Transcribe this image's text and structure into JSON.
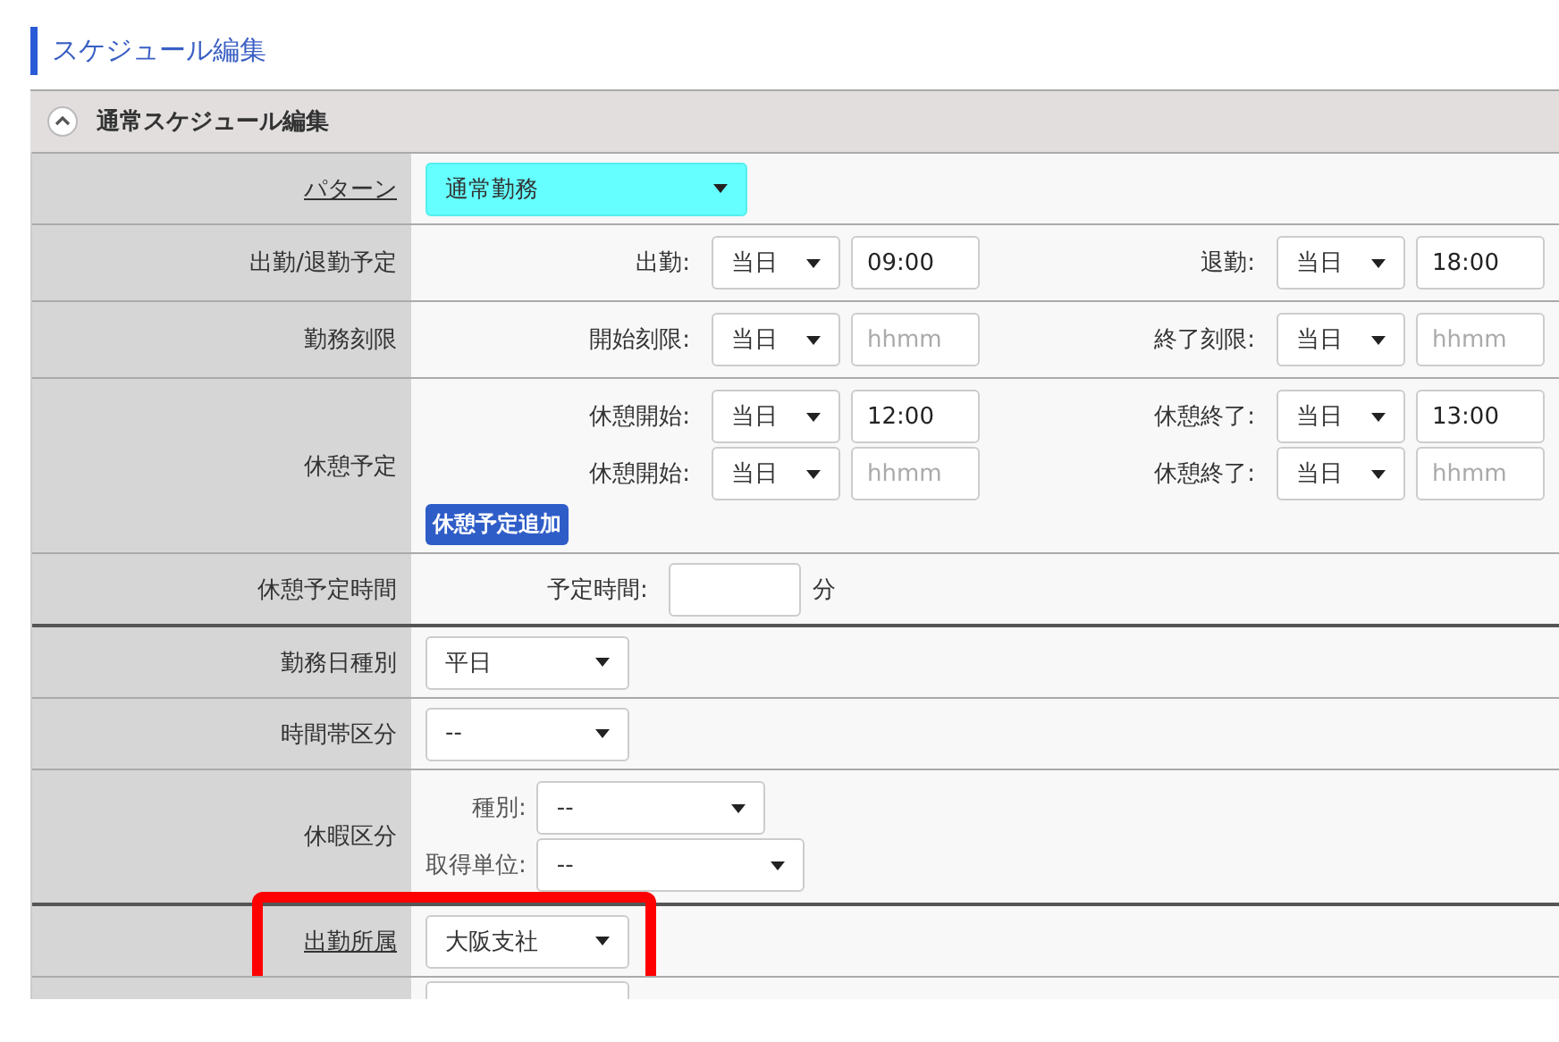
{
  "page_title": "スケジュール編集",
  "section": {
    "title": "通常スケジュール編集",
    "expanded": true
  },
  "rows": [
    {
      "kind": "select",
      "label": "パターン",
      "label_link": true,
      "select": {
        "value": "通常勤務",
        "accent": true
      }
    },
    {
      "kind": "pairs",
      "label": "出勤/退勤予定",
      "lines": [
        [
          {
            "label": "出勤:",
            "day": "当日",
            "time": {
              "value": "09:00"
            }
          },
          {
            "label": "退勤:",
            "day": "当日",
            "time": {
              "value": "18:00"
            }
          }
        ]
      ]
    },
    {
      "kind": "pairs",
      "label": "勤務刻限",
      "lines": [
        [
          {
            "label": "開始刻限:",
            "day": "当日",
            "time": {
              "placeholder": "hhmm"
            }
          },
          {
            "label": "終了刻限:",
            "day": "当日",
            "time": {
              "placeholder": "hhmm"
            }
          }
        ]
      ]
    },
    {
      "kind": "pairs",
      "label": "休憩予定",
      "lines": [
        [
          {
            "label": "休憩開始:",
            "day": "当日",
            "time": {
              "value": "12:00"
            }
          },
          {
            "label": "休憩終了:",
            "day": "当日",
            "time": {
              "value": "13:00"
            }
          }
        ],
        [
          {
            "label": "休憩開始:",
            "day": "当日",
            "time": {
              "placeholder": "hhmm"
            }
          },
          {
            "label": "休憩終了:",
            "day": "当日",
            "time": {
              "placeholder": "hhmm"
            }
          }
        ]
      ],
      "button": "休憩予定追加"
    },
    {
      "kind": "duration",
      "label": "休憩予定時間",
      "field_label": "予定時間:",
      "unit": "分",
      "divider_after": true
    },
    {
      "kind": "select",
      "label": "勤務日種別",
      "label_link": false,
      "select": {
        "value": "平日",
        "accent": false
      }
    },
    {
      "kind": "select",
      "label": "時間帯区分",
      "label_link": false,
      "select": {
        "value": "--",
        "accent": false
      }
    },
    {
      "kind": "leave",
      "label": "休暇区分",
      "fields": [
        {
          "label": "種別:",
          "value": "--"
        },
        {
          "label": "取得単位:",
          "value": "--"
        }
      ],
      "divider_after": true
    },
    {
      "kind": "select",
      "label": "出勤所属",
      "label_link": true,
      "highlighted": true,
      "select": {
        "value": "大阪支社",
        "accent": false
      }
    },
    {
      "kind": "partial"
    }
  ]
}
